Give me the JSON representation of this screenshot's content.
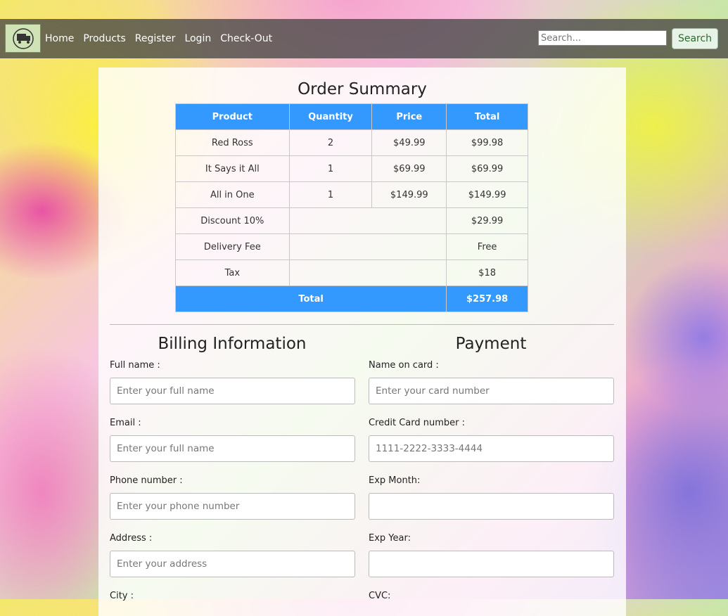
{
  "navbar": {
    "links": [
      "Home",
      "Products",
      "Register",
      "Login",
      "Check-Out"
    ],
    "search_placeholder": "Search...",
    "search_button": "Search"
  },
  "summary": {
    "title": "Order Summary",
    "headers": [
      "Product",
      "Quantity",
      "Price",
      "Total"
    ],
    "items": [
      {
        "product": "Red Ross",
        "quantity": "2",
        "price": "$49.99",
        "total": "$99.98"
      },
      {
        "product": "It Says it All",
        "quantity": "1",
        "price": "$69.99",
        "total": "$69.99"
      },
      {
        "product": "All in One",
        "quantity": "1",
        "price": "$149.99",
        "total": "$149.99"
      }
    ],
    "extras": [
      {
        "label": "Discount 10%",
        "value": "$29.99"
      },
      {
        "label": "Delivery Fee",
        "value": "Free"
      },
      {
        "label": "Tax",
        "value": "$18"
      }
    ],
    "total_label": "Total",
    "total_value": "$257.98"
  },
  "billing": {
    "title": "Billing Information",
    "fields": [
      {
        "label": "Full name :",
        "placeholder": "Enter your full name"
      },
      {
        "label": "Email :",
        "placeholder": "Enter your full name"
      },
      {
        "label": "Phone number :",
        "placeholder": "Enter your phone number"
      },
      {
        "label": "Address :",
        "placeholder": "Enter your address"
      },
      {
        "label": "City :",
        "placeholder": ""
      }
    ]
  },
  "payment": {
    "title": "Payment",
    "fields": [
      {
        "label": "Name on card :",
        "placeholder": "Enter your card number"
      },
      {
        "label": "Credit Card number :",
        "placeholder": "1111-2222-3333-4444"
      },
      {
        "label": "Exp Month:",
        "placeholder": ""
      },
      {
        "label": "Exp Year:",
        "placeholder": ""
      },
      {
        "label": "CVC:",
        "placeholder": ""
      }
    ]
  }
}
